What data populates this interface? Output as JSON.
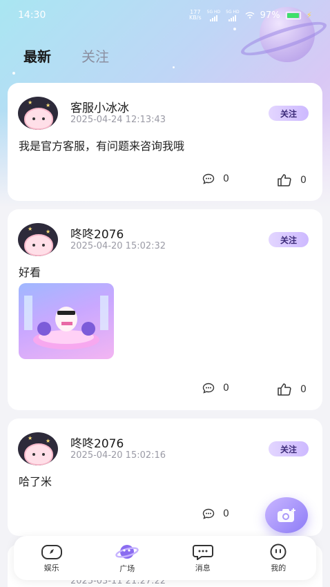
{
  "status_bar": {
    "time": "14:30",
    "net_speed_top": "177",
    "net_speed_unit": "KB/s",
    "sim1": "5G HD",
    "sim2": "5G HD",
    "battery": "97%"
  },
  "tabs": [
    {
      "label": "最新",
      "active": true
    },
    {
      "label": "关注",
      "active": false
    }
  ],
  "posts": [
    {
      "username": "客服小冰冰",
      "time": "2025-04-24 12:13:43",
      "follow_label": "关注",
      "text": "我是官方客服，有问题来咨询我哦",
      "comments": "0",
      "likes": "0",
      "has_image": false
    },
    {
      "username": "咚咚2076",
      "time": "2025-04-20 15:02:32",
      "follow_label": "关注",
      "text": "好看",
      "comments": "0",
      "likes": "0",
      "has_image": true
    },
    {
      "username": "咚咚2076",
      "time": "2025-04-20 15:02:16",
      "follow_label": "关注",
      "text": "哈了米",
      "comments": "0",
      "has_image": false
    },
    {
      "time": "2025-03-11 21:27:22"
    }
  ],
  "bottom_nav": [
    {
      "label": "娱乐",
      "icon": "entertainment-icon"
    },
    {
      "label": "广场",
      "icon": "planet-icon",
      "active": true
    },
    {
      "label": "消息",
      "icon": "message-icon"
    },
    {
      "label": "我的",
      "icon": "profile-icon"
    }
  ],
  "colors": {
    "accent": "#9b87f5",
    "follow_bg": "#d9c9ff",
    "battery_green": "#3fe06b"
  }
}
